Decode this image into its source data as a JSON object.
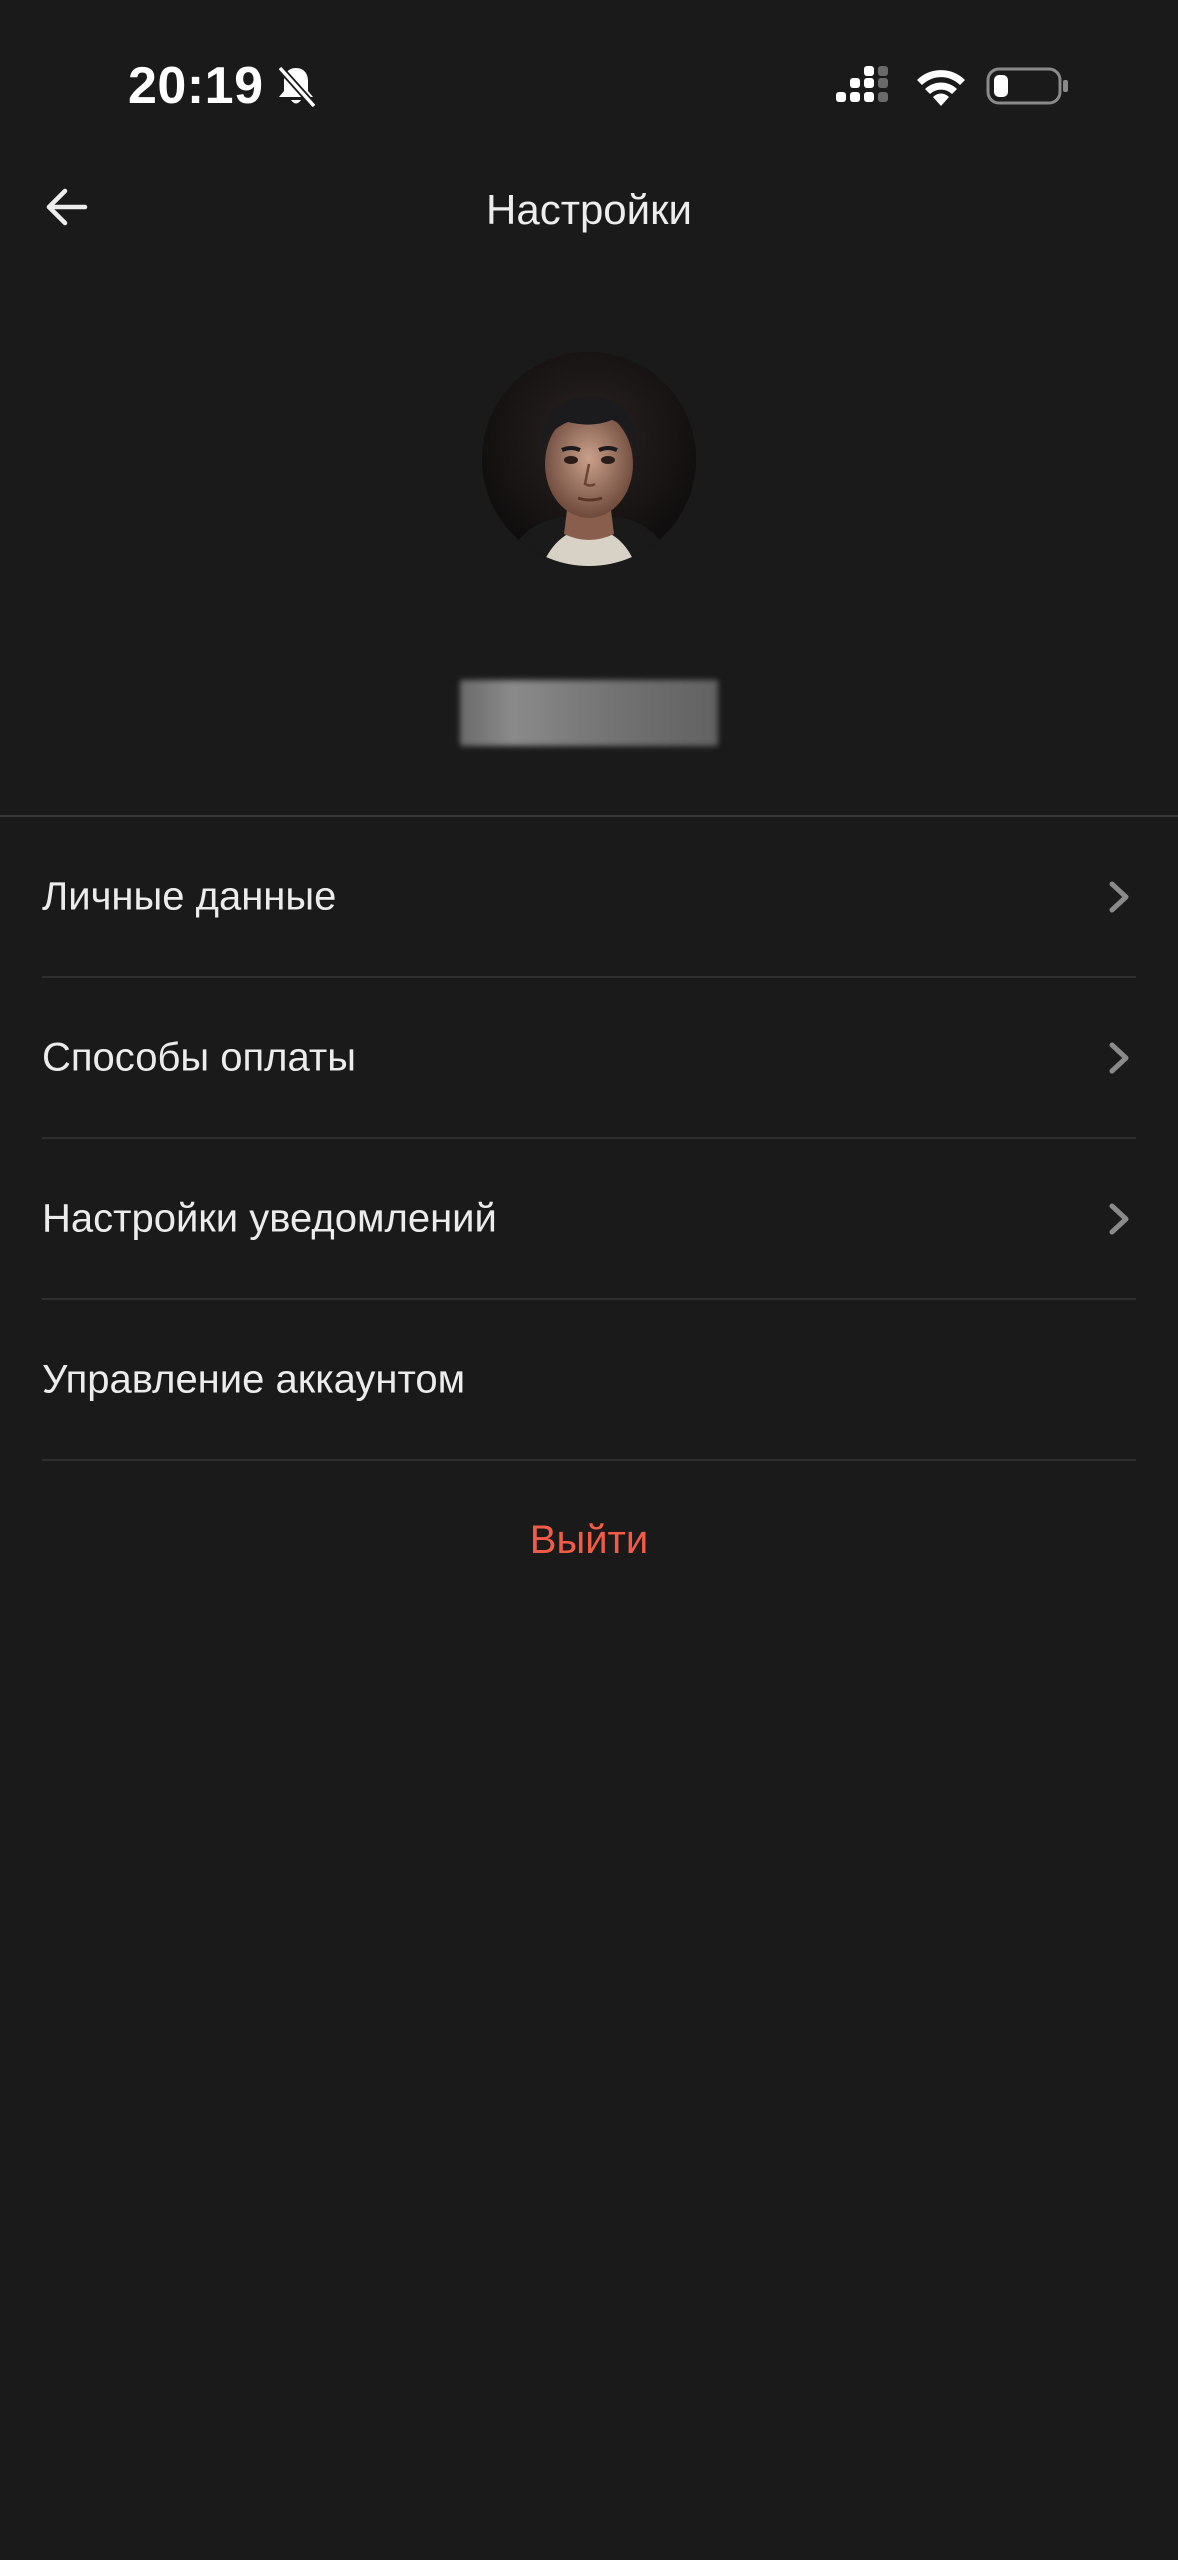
{
  "status_bar": {
    "time": "20:19",
    "icons": [
      "bell-off-icon",
      "cellular-signal-icon",
      "wifi-icon",
      "battery-icon"
    ]
  },
  "header": {
    "title": "Настройки",
    "back_icon": "arrow-left-icon"
  },
  "profile": {
    "avatar": "user-photo",
    "name_obscured": true
  },
  "menu": {
    "items": [
      {
        "label": "Личные данные",
        "has_chevron": true
      },
      {
        "label": "Способы оплаты",
        "has_chevron": true
      },
      {
        "label": "Настройки уведомлений",
        "has_chevron": true
      },
      {
        "label": "Управление аккаунтом",
        "has_chevron": false
      }
    ]
  },
  "logout": {
    "label": "Выйти"
  },
  "colors": {
    "background": "#1a1a1a",
    "text": "#ececec",
    "divider": "#2f2f2f",
    "logout": "#f25b45",
    "chevron": "#8a8a8a"
  }
}
